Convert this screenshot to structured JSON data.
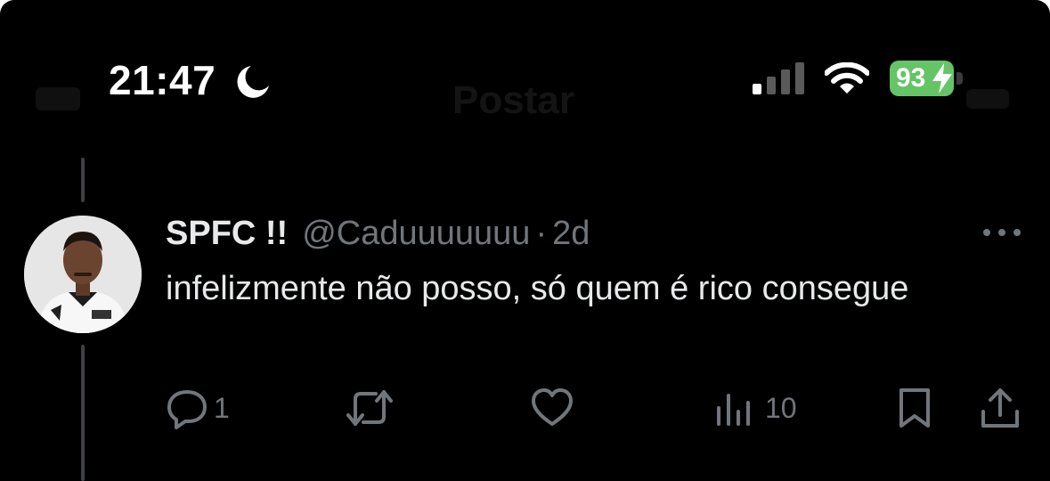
{
  "status_bar": {
    "time": "21:47",
    "battery_level": "93",
    "focus_icon": "moon-icon",
    "signal_icon": "cellular-signal-icon",
    "wifi_icon": "wifi-icon",
    "battery_icon": "battery-charging-icon"
  },
  "nav": {
    "title": "Postar"
  },
  "tweet": {
    "display_name": "SPFC !!",
    "handle": "@Caduuuuuuu",
    "separator": "·",
    "age": "2d",
    "text": "infelizmente não posso, só quem é rico consegue",
    "more_icon": "more-horizontal-icon",
    "actions": {
      "reply": {
        "icon": "reply-icon",
        "count": "1"
      },
      "retweet": {
        "icon": "retweet-icon",
        "count": ""
      },
      "like": {
        "icon": "heart-icon",
        "count": ""
      },
      "views": {
        "icon": "views-icon",
        "count": "10"
      },
      "bookmark": {
        "icon": "bookmark-icon"
      },
      "share": {
        "icon": "share-icon"
      }
    }
  },
  "colors": {
    "background": "#000000",
    "text_primary": "#e7e9ea",
    "text_secondary": "#71767b",
    "thread_line": "#3e4144",
    "battery": "#65c466"
  }
}
